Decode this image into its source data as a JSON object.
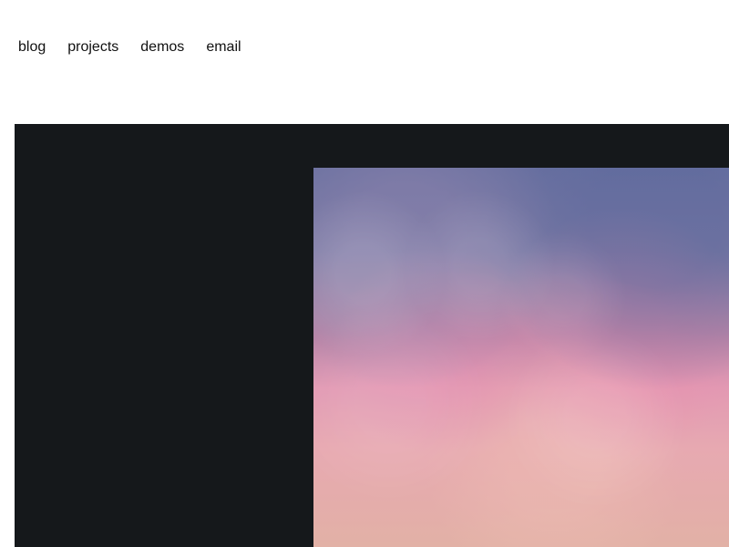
{
  "nav": {
    "items": [
      {
        "label": "blog"
      },
      {
        "label": "projects"
      },
      {
        "label": "demos"
      },
      {
        "label": "email"
      }
    ]
  },
  "colors": {
    "background": "#ffffff",
    "hero_background": "#15181b",
    "nav_text": "#111111"
  }
}
